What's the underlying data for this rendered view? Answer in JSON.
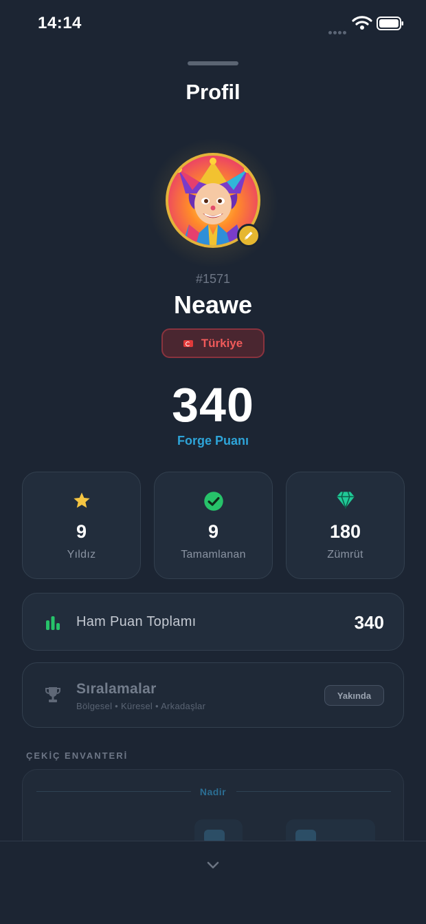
{
  "status_bar": {
    "time": "14:14",
    "signal_icon": "cellular-dots-icon",
    "wifi_icon": "wifi-icon",
    "battery_icon": "battery-icon"
  },
  "header": {
    "title": "Profil"
  },
  "profile": {
    "avatar": "jester-avatar",
    "edit_icon": "pencil-icon",
    "id": "#1571",
    "name": "Neawe",
    "country": "Türkiye",
    "country_flag": "turkey-flag-icon"
  },
  "score": {
    "value": "340",
    "label": "Forge Puanı"
  },
  "stats": [
    {
      "icon": "star-icon",
      "value": "9",
      "label": "Yıldız",
      "color": "#f5c542"
    },
    {
      "icon": "check-circle-icon",
      "value": "9",
      "label": "Tamamlanan",
      "color": "#27c26a"
    },
    {
      "icon": "gem-icon",
      "value": "180",
      "label": "Zümrüt",
      "color": "#20c997"
    }
  ],
  "raw_score": {
    "label": "Ham Puan Toplamı",
    "value": "340",
    "icon": "bar-chart-icon"
  },
  "rankings": {
    "title": "Sıralamalar",
    "subtitle": "Bölgesel • Küresel • Arkadaşlar",
    "badge": "Yakında",
    "icon": "trophy-icon"
  },
  "inventory": {
    "section_title": "ÇEKİÇ ENVANTERİ",
    "rarity_label": "Nadir"
  },
  "footer": {
    "icon": "chevron-down-icon"
  },
  "colors": {
    "background": "#1c2533",
    "card": "#222d3c",
    "accent_blue": "#2ea4d8",
    "accent_gold": "#e3b33a",
    "country_red": "#f05a5a"
  }
}
